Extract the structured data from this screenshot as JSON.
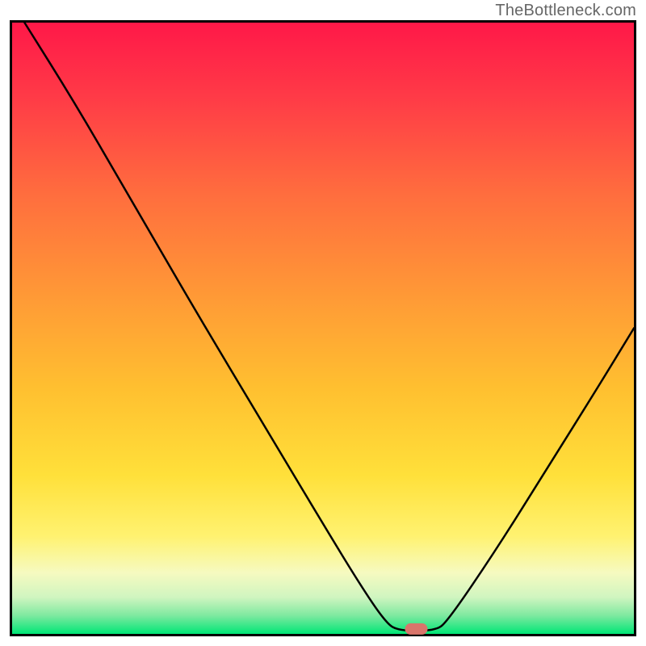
{
  "attribution": "TheBottleneck.com",
  "chart_data": {
    "type": "line",
    "title": "",
    "xlabel": "",
    "ylabel": "",
    "xlim": [
      0,
      100
    ],
    "ylim": [
      0,
      100
    ],
    "gradient_colors": {
      "top": "#ff1744",
      "upper_mid": "#ff6d3a",
      "mid": "#ffb32e",
      "lower_mid": "#ffe93b",
      "pale": "#f7fca0",
      "bottom": "#00e676"
    },
    "curve": {
      "description": "V-shaped bottleneck curve with minimum near x=65",
      "points": [
        {
          "x": 2,
          "y": 100
        },
        {
          "x": 10,
          "y": 87
        },
        {
          "x": 18,
          "y": 73
        },
        {
          "x": 22,
          "y": 66
        },
        {
          "x": 30,
          "y": 52
        },
        {
          "x": 40,
          "y": 35
        },
        {
          "x": 50,
          "y": 18
        },
        {
          "x": 56,
          "y": 8
        },
        {
          "x": 60,
          "y": 2
        },
        {
          "x": 62,
          "y": 0.5
        },
        {
          "x": 68,
          "y": 0.5
        },
        {
          "x": 70,
          "y": 2
        },
        {
          "x": 78,
          "y": 14
        },
        {
          "x": 86,
          "y": 27
        },
        {
          "x": 94,
          "y": 40
        },
        {
          "x": 100,
          "y": 50
        }
      ]
    },
    "marker": {
      "x": 65,
      "y": 0.8,
      "color": "#d9756b",
      "shape": "rounded_rect"
    },
    "border_color": "#000000",
    "border_width": 3
  }
}
